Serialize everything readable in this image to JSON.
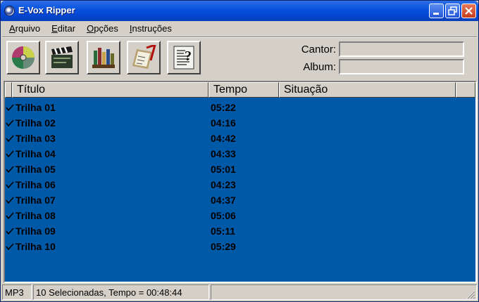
{
  "window": {
    "title": "E-Vox Ripper"
  },
  "menu": [
    {
      "key": "A",
      "rest": "rquivo"
    },
    {
      "key": "E",
      "rest": "ditar"
    },
    {
      "key": "O",
      "rest": "pções"
    },
    {
      "key": "I",
      "rest": "nstruções"
    }
  ],
  "toolbar": {
    "icons": [
      "cd-disc-icon",
      "clapperboard-icon",
      "library-icon",
      "clipboard-check-icon",
      "help-document-icon"
    ]
  },
  "fields": {
    "singer_label": "Cantor:",
    "singer_value": "",
    "album_label": "Album:",
    "album_value": ""
  },
  "list": {
    "columns": [
      "Título",
      "Tempo",
      "Situação"
    ],
    "rows": [
      {
        "name": "Trilha 01",
        "time": "05:22",
        "status": ""
      },
      {
        "name": "Trilha 02",
        "time": "04:16",
        "status": ""
      },
      {
        "name": "Trilha 03",
        "time": "04:42",
        "status": ""
      },
      {
        "name": "Trilha 04",
        "time": "04:33",
        "status": ""
      },
      {
        "name": "Trilha 05",
        "time": "05:01",
        "status": ""
      },
      {
        "name": "Trilha 06",
        "time": "04:23",
        "status": ""
      },
      {
        "name": "Trilha 07",
        "time": "04:37",
        "status": ""
      },
      {
        "name": "Trilha 08",
        "time": "05:06",
        "status": ""
      },
      {
        "name": "Trilha 09",
        "time": "05:11",
        "status": ""
      },
      {
        "name": "Trilha 10",
        "time": "05:29",
        "status": ""
      }
    ]
  },
  "statusbar": {
    "format": "MP3",
    "summary": "10 Selecionadas, Tempo = 00:48:44",
    "extra": ""
  },
  "colors": {
    "titlebar": "#0a54e0",
    "list_background": "#0059a7",
    "face": "#d4d0c8"
  }
}
